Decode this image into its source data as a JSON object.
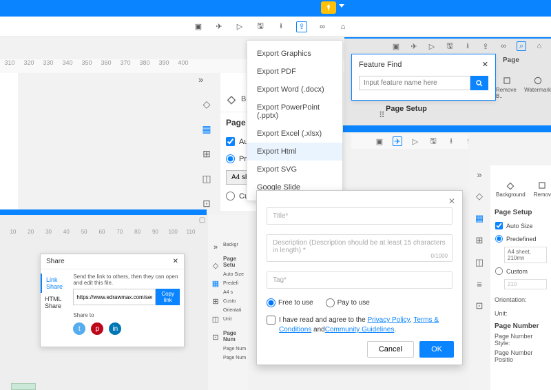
{
  "topbar": {
    "diamond": "◆"
  },
  "ruler_top": [
    "310",
    "320",
    "330",
    "340",
    "350",
    "360",
    "370",
    "380",
    "390",
    "400"
  ],
  "panel": {
    "background_label": "Backgroun",
    "page_setup": "Page Setu",
    "auto_size": "Auto Siz",
    "predefined": "Predefined",
    "preset_value": "A4 sheet, 210mm x 297 mm",
    "custom": "Custom"
  },
  "export_menu": {
    "items": [
      "Export Graphics",
      "Export PDF",
      "Export Word (.docx)",
      "Export PowerPoint (.pptx)",
      "Export Excel (.xlsx)",
      "Export Html",
      "Export SVG",
      "Google Slide"
    ],
    "selected_index": 5
  },
  "feature_find": {
    "title": "Feature Find",
    "placeholder": "Input feature name here",
    "right_cols": {
      "page": "Page",
      "remove": "Remove B..",
      "watermark": "Watermark"
    },
    "page_setup": "Page Setup"
  },
  "share_ruler": [
    "10",
    "20",
    "30",
    "40",
    "50",
    "60",
    "70",
    "80",
    "90",
    "100",
    "110"
  ],
  "share": {
    "title": "Share",
    "tab_link": "Link Share",
    "tab_html": "HTML Share",
    "hint": "Send the link to others, then they can open and edit this file.",
    "url": "https://www.edrawmax.com/server/pu",
    "copy": "Copy link",
    "share_to": "Share to"
  },
  "midpanel": {
    "backgr": "Backgr",
    "page_setu": "Page Setu",
    "auto_size": "Auto Size",
    "predefi": "Predefi",
    "a4": "A4 s",
    "custo": "Custo",
    "orient": "Orientati",
    "unit": "Unit",
    "page_num": "Page Num",
    "page_num2": "Page Num",
    "page_num3": "Page Num"
  },
  "publish": {
    "title_ph": "Title*",
    "desc_ph": "Description  (Description should be at least 15 characters in length)  *",
    "count": "0/1000",
    "tag_ph": "Tag*",
    "free": "Free to use",
    "pay": "Pay to use",
    "agree_pre": "I have read and agree to the ",
    "privacy": "Privacy Policy",
    "terms": "Terms & Conditions",
    "and": " and",
    "community": "Community Guidelines",
    "cancel": "Cancel",
    "ok": "OK"
  },
  "br": {
    "pa": "Pa",
    "background": "Background",
    "remove": "Remov",
    "page_setup": "Page Setup",
    "auto_size": "Auto Size",
    "predefined": "Predefined",
    "preset": "A4 sheet, 210mn",
    "custom": "Custom",
    "box210": "210",
    "orientation": "Orientation:",
    "unit": "Unit:",
    "page_number": "Page Number",
    "pns": "Page Number Style:",
    "pnp": "Page Number Positio"
  }
}
